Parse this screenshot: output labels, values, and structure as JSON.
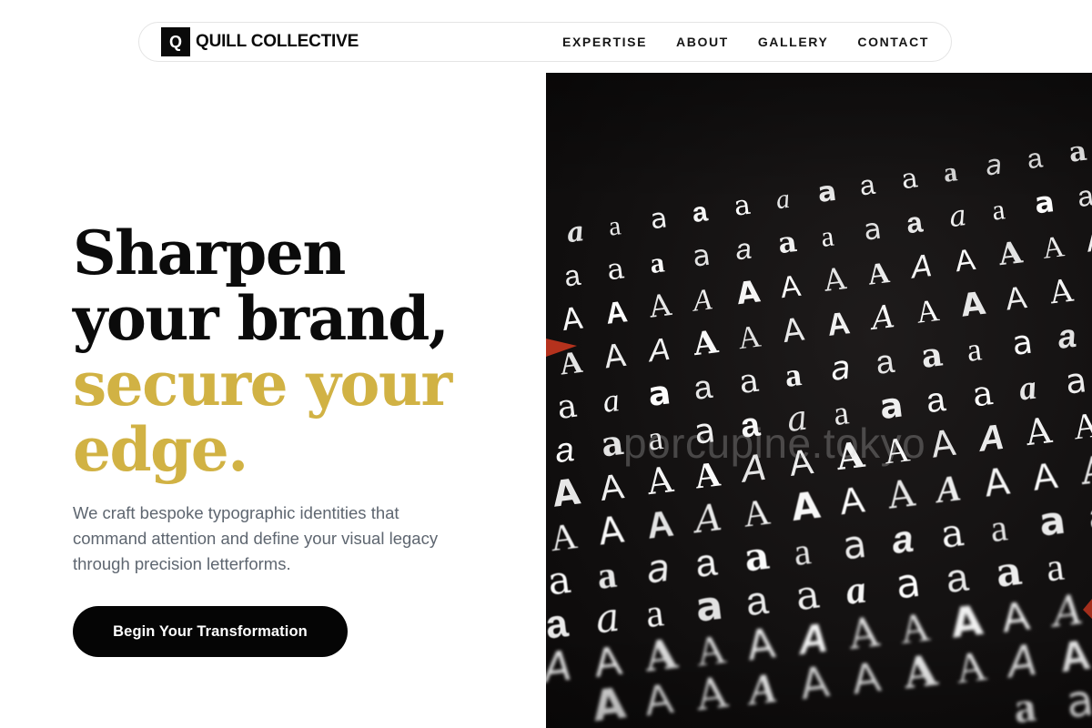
{
  "brand": {
    "mark": "Q",
    "name": "QUILL COLLECTIVE"
  },
  "nav": {
    "links": [
      "EXPERTISE",
      "ABOUT",
      "GALLERY",
      "CONTACT"
    ]
  },
  "hero": {
    "title_lines": [
      "Sharpen",
      "your brand,",
      "secure your",
      "edge."
    ],
    "subtitle": "We craft bespoke typographic identities that command attention and define your visual legacy through precision letterforms.",
    "cta_label": "Begin Your Transformation"
  },
  "image": {
    "alt": "Rows of letter A glyphs in various typefaces printed white on black",
    "watermark": "porcupine.tokyo",
    "glyph_lower": "a",
    "glyph_upper": "A"
  },
  "colors": {
    "accent": "#d1b244",
    "primary": "#0b0b0b",
    "subtitle": "#5e6670",
    "button_bg": "#050505",
    "image_bg": "#121010"
  }
}
